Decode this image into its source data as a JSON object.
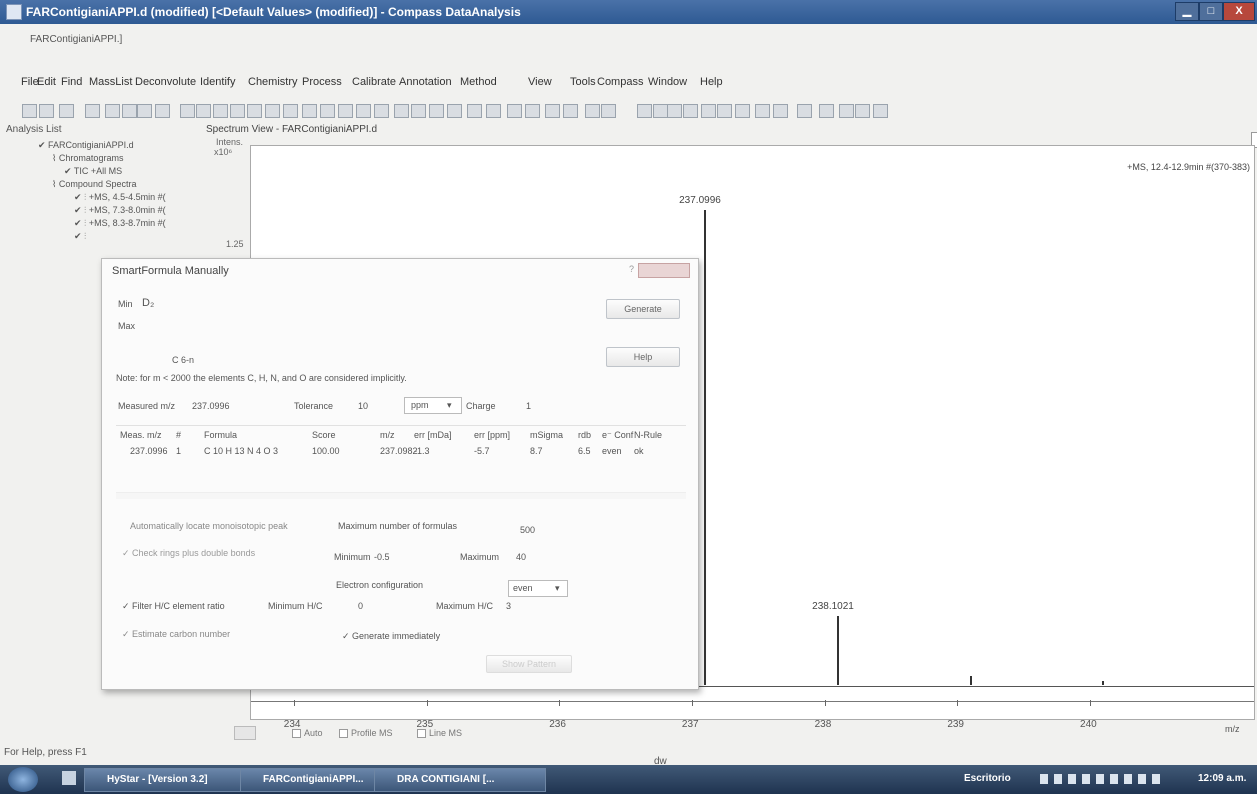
{
  "window": {
    "title": "FARContigianiAPPI.d (modified) [<Default Values> (modified)] - Compass DataAnalysis",
    "subtitle": "FARContigianiAPPI.]",
    "minimize": "▁",
    "maximize": "□",
    "close": "X"
  },
  "menu": [
    "File",
    "Edit",
    "Find",
    "MassList",
    "Deconvolute",
    "Identify",
    "Chemistry",
    "Process",
    "Calibrate",
    "Annotation",
    "Method",
    "View",
    "Tools",
    "Compass",
    "Window",
    "Help"
  ],
  "analysis_list": {
    "header": "Analysis List",
    "items": [
      "FARContigianiAPPI.d",
      "Chromatograms",
      "TIC +All MS",
      "Compound Spectra",
      "+MS, 4.5-4.5min #(",
      "+MS, 7.3-8.0min #(",
      "+MS, 8.3-8.7min #("
    ]
  },
  "spectrum": {
    "header": "Spectrum View - FARContigianiAPPI.d",
    "y_label": "Intens.",
    "y_exp": "x10⁶",
    "y_tick": "1.25",
    "info": "+MS, 12.4-12.9min #(370-383)",
    "x_unit": "m/z",
    "auto": "Auto",
    "profile": "Profile MS",
    "line": "Line MS"
  },
  "chart_data": {
    "type": "line",
    "xlim": [
      233.7,
      241.1
    ],
    "x_ticks": [
      "234",
      "235",
      "236",
      "237",
      "238",
      "239",
      "240"
    ],
    "peaks": [
      {
        "mz": 237.0996,
        "label": "237.0996",
        "rel": 1.0
      },
      {
        "mz": 238.1021,
        "label": "238.1021",
        "rel": 0.145
      },
      {
        "mz": 239.1,
        "label": "",
        "rel": 0.018
      },
      {
        "mz": 240.1,
        "label": "",
        "rel": 0.009
      }
    ]
  },
  "dialog": {
    "title": "SmartFormula Manually",
    "min_label": "Min",
    "min_value": "D₂",
    "max_label": "Max",
    "formula_hint": "C 6-n",
    "generate": "Generate",
    "help": "Help",
    "note": "Note: for m < 2000 the elements C, H, N, and O are considered implicitly.",
    "measured_label": "Measured m/z",
    "measured_value": "237.0996",
    "tolerance_label": "Tolerance",
    "tolerance_value": "10",
    "tolerance_unit": "ppm",
    "charge_label": "Charge",
    "charge_value": "1",
    "table": {
      "columns": [
        "Meas. m/z",
        "#",
        "Formula",
        "Score",
        "m/z",
        "err [mDa]",
        "err [ppm]",
        "mSigma",
        "rdb",
        "e⁻ Conf",
        "N-Rule"
      ],
      "rows": [
        [
          "237.0996",
          "1",
          "C 10 H 13 N 4 O 3",
          "100.00",
          "237.0982",
          "-1.3",
          "-5.7",
          "8.7",
          "6.5",
          "even",
          "ok"
        ]
      ]
    },
    "auto_locate": "Automatically locate monoisotopic peak",
    "max_formulas_label": "Maximum number of formulas",
    "max_formulas_value": "500",
    "check_rings": "Check rings plus double bonds",
    "minimum_label": "Minimum",
    "minimum_value": "-0.5",
    "maximum_label": "Maximum",
    "maximum_value": "40",
    "electron_label": "Electron configuration",
    "electron_value": "even",
    "filter_hc": "Filter H/C element ratio",
    "min_hc_label": "Minimum H/C",
    "min_hc_value": "0",
    "max_hc_label": "Maximum H/C",
    "max_hc_value": "3",
    "estimate_carbon": "Estimate carbon number",
    "generate_immediately": "Generate immediately",
    "show_pattern": "Show Pattern"
  },
  "statusbar": {
    "help": "For Help, press F1",
    "center": "dw"
  },
  "taskbar": {
    "items": [
      "HyStar - [Version 3.2]",
      "FARContigianiAPPI...",
      "DRA CONTIGIANI [..."
    ],
    "tray_label": "Escritorio",
    "clock": "12:09 a.m."
  }
}
